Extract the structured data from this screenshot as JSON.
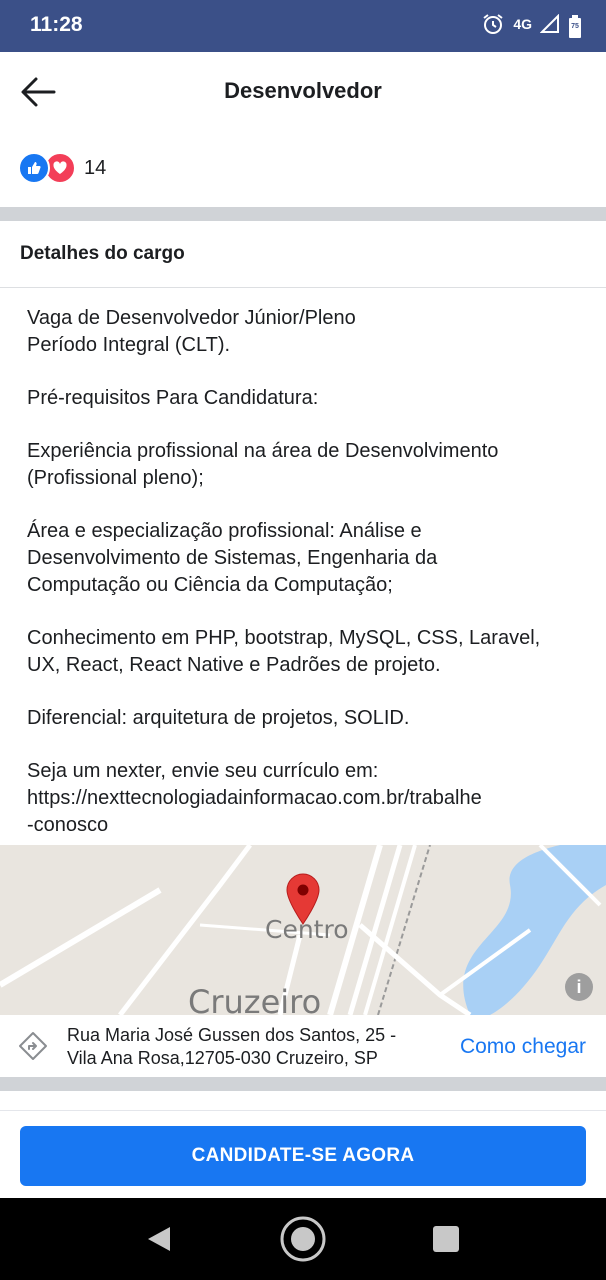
{
  "status_bar": {
    "time": "11:28",
    "network": "4G",
    "battery": "75"
  },
  "header": {
    "title": "Desenvolvedor"
  },
  "reactions": {
    "count": "14"
  },
  "section": {
    "title": "Detalhes do cargo"
  },
  "description": {
    "paragraphs": [
      "Vaga de Desenvolvedor Júnior/Pleno\nPeríodo Integral (CLT).",
      "Pré-requisitos Para Candidatura:",
      "Experiência profissional na área de Desenvolvimento\n(Profissional pleno);",
      "Área e especialização profissional: Análise e\nDesenvolvimento de Sistemas, Engenharia da\nComputação ou Ciência da Computação;",
      "Conhecimento em PHP, bootstrap, MySQL, CSS, Laravel,\nUX, React, React Native e Padrões de projeto.",
      "Diferencial: arquitetura de projetos, SOLID.",
      "Seja um nexter, envie seu currículo em:\nhttps://nexttecnologiadainformacao.com.br/trabalhe\n-conosco"
    ]
  },
  "map": {
    "labels": {
      "centro": "Centro",
      "cruzeiro": "Cruzeiro"
    }
  },
  "location": {
    "address": "Rua Maria José Gussen dos Santos, 25 -\nVila Ana Rosa,12705-030 Cruzeiro, SP",
    "directions_label": "Como chegar"
  },
  "apply": {
    "label": "CANDIDATE-SE AGORA"
  },
  "colors": {
    "status_bar": "#3b5088",
    "accent": "#1877f2",
    "separator": "#d0d3d7"
  }
}
